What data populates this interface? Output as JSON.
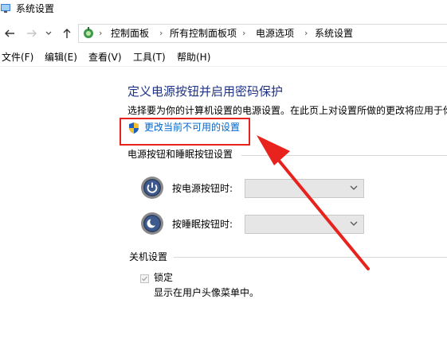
{
  "window": {
    "title": "系统设置"
  },
  "nav": {
    "breadcrumbs": [
      "控制面板",
      "所有控制面板项",
      "电源选项",
      "系统设置"
    ]
  },
  "menu": [
    "文件(F)",
    "编辑(E)",
    "查看(V)",
    "工具(T)",
    "帮助(H)"
  ],
  "main": {
    "heading": "定义电源按钮并启用密码保护",
    "description": "选择要为你的计算机设置的电源设置。在此页上对设置所做的更改将应用于你",
    "change_link": "更改当前不可用的设置",
    "power_group": {
      "header": "电源按钮和睡眠按钮设置",
      "power_button_label": "按电源按钮时:",
      "power_button_value": "",
      "sleep_button_label": "按睡眠按钮时:",
      "sleep_button_value": ""
    },
    "shutdown_group": {
      "header": "关机设置",
      "lock_label": "锁定",
      "lock_checked": true,
      "lock_desc": "显示在用户头像菜单中。"
    }
  },
  "colors": {
    "heading": "#1e3287",
    "link": "#0066cc",
    "annotation": "#e8231d"
  }
}
